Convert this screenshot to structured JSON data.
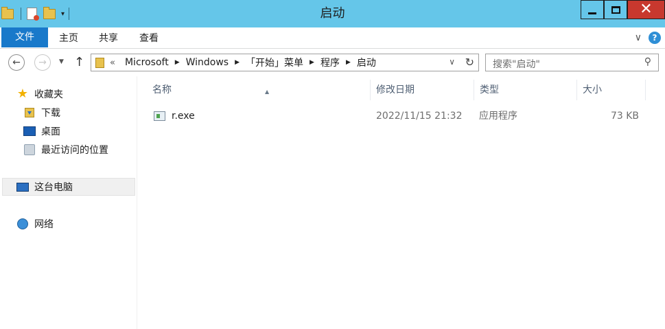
{
  "window": {
    "title": "启动",
    "controls": {
      "minimize": "minimize-icon",
      "maximize": "maximize-icon",
      "close": "close-icon"
    }
  },
  "quick_access_toolbar": {
    "items": [
      "folder-icon",
      "properties-icon",
      "new-folder-icon"
    ]
  },
  "ribbon": {
    "tabs": [
      {
        "label": "文件",
        "active": true
      },
      {
        "label": "主页"
      },
      {
        "label": "共享"
      },
      {
        "label": "查看"
      }
    ]
  },
  "address_bar": {
    "overflow": "«",
    "crumbs": [
      "Microsoft",
      "Windows",
      "「开始」菜单",
      "程序",
      "启动"
    ]
  },
  "search": {
    "placeholder": "搜索\"启动\""
  },
  "sidebar": {
    "favorites": {
      "label": "收藏夹",
      "items": [
        "下载",
        "桌面",
        "最近访问的位置"
      ]
    },
    "this_pc": "这台电脑",
    "network": "网络"
  },
  "columns": {
    "name": "名称",
    "date": "修改日期",
    "type": "类型",
    "size": "大小"
  },
  "files": [
    {
      "name": "r.exe",
      "date": "2022/11/15 21:32",
      "type": "应用程序",
      "size": "73 KB"
    }
  ],
  "colors": {
    "titlebar": "#65c6e9",
    "file_tab": "#1979ca",
    "close": "#c8382e"
  }
}
